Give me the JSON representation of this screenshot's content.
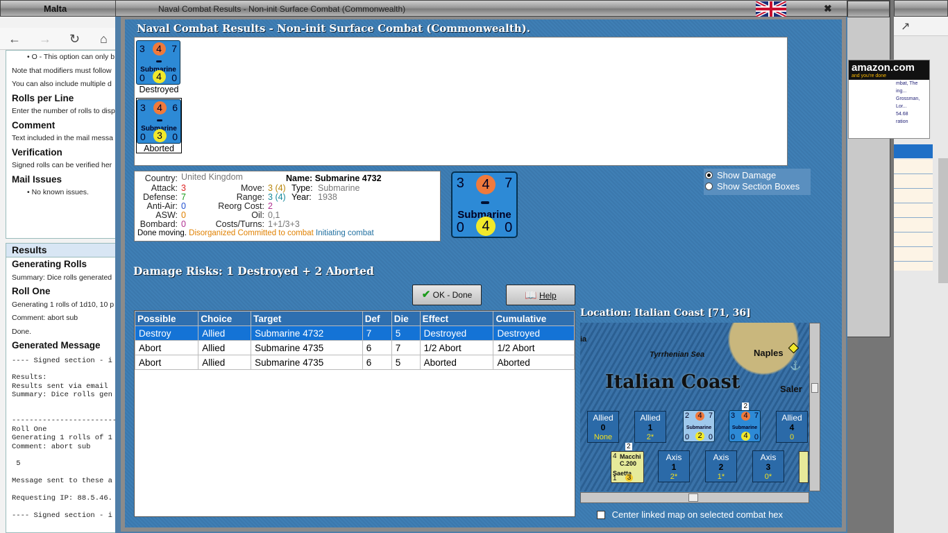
{
  "left_browser": {
    "window_title": "Malta",
    "doc_lines": [
      {
        "kind": "bullet",
        "text": "O - This option can only b"
      },
      {
        "kind": "text",
        "text": "Note that modifiers must follow"
      },
      {
        "kind": "text",
        "text": "You can also include multiple d"
      },
      {
        "kind": "heading",
        "text": "Rolls per Line"
      },
      {
        "kind": "text",
        "text": "Enter the number of rolls to disp"
      },
      {
        "kind": "heading",
        "text": "Comment"
      },
      {
        "kind": "text",
        "text": "Text included in the mail messa"
      },
      {
        "kind": "heading",
        "text": "Verification"
      },
      {
        "kind": "text",
        "text": "Signed rolls can be verified her"
      },
      {
        "kind": "heading",
        "text": "Mail Issues"
      },
      {
        "kind": "bullet",
        "text": "No known issues."
      }
    ],
    "results_title": "Results",
    "results_lines": [
      {
        "kind": "heading",
        "text": "Generating Rolls"
      },
      {
        "kind": "text",
        "text": "Summary: Dice rolls generated"
      },
      {
        "kind": "heading",
        "text": "Roll One"
      },
      {
        "kind": "text",
        "text": "Generating 1 rolls of 1d10, 10 p"
      },
      {
        "kind": "text",
        "text": "Comment: abort sub"
      },
      {
        "kind": "text",
        "text": "Done."
      },
      {
        "kind": "heading",
        "text": "Generated Message"
      }
    ],
    "mono_text": "---- Signed section - i\n\nResults:\nResults sent via email\nSummary: Dice rolls gen\n\n\n------------------------\nRoll One\nGenerating 1 rolls of 1\nComment: abort sub\n\n 5\n\nMessage sent to these a\n\nRequesting IP: 88.5.46.\n\n---- Signed section - i"
  },
  "right_bg": {
    "ad_logo": "amazon.com",
    "ad_tag": "and you're done",
    "ad_lines": [
      "mbat, The",
      "ing...",
      "Grossman, Lor...",
      "54.68",
      "ration"
    ]
  },
  "dialog": {
    "window_title": "Naval Combat Results - Non-init Surface Combat (Commonwealth)",
    "heading": "Naval Combat Results - Non-init Surface Combat (Commonwealth).",
    "results_units": [
      {
        "attack": "3",
        "def": "4",
        "move": "7",
        "name": "Submarine",
        "oil": "0",
        "die": "4",
        "range": "0",
        "status": "Destroyed"
      },
      {
        "attack": "3",
        "def": "4",
        "move": "6",
        "name": "Submarine",
        "oil": "0",
        "die": "3",
        "range": "0",
        "status": "Aborted"
      }
    ],
    "info": {
      "country_label": "Country:",
      "country": "United Kingdom",
      "name_label": "Name:",
      "name": "Submarine 4732",
      "attack_label": "Attack:",
      "attack": "3",
      "defense_label": "Defense:",
      "defense": "7",
      "aa_label": "Anti-Air:",
      "aa": "0",
      "asw_label": "ASW:",
      "asw": "0",
      "bombard_label": "Bombard:",
      "bombard": "0",
      "move_label": "Move:",
      "move": "3",
      "move_paren": "(4)",
      "type_label": "Type:",
      "type": "Submarine",
      "range_label": "Range:",
      "range": "3",
      "range_paren": "(4)",
      "year_label": "Year:",
      "year": "1938",
      "reorg_label": "Reorg Cost:",
      "reorg": "2",
      "oil_label": "Oil:",
      "oil": "0,1",
      "costs_label": "Costs/Turns:",
      "costs": "1+1/3+3",
      "status_done": "Done moving.",
      "status_disorg": "Disorganized",
      "status_committed": "Committed to combat",
      "status_init": "Initiating combat"
    },
    "big_counter": {
      "attack": "3",
      "def": "4",
      "move": "7",
      "name": "Submarine",
      "oil": "0",
      "die": "4",
      "range": "0"
    },
    "options": {
      "show_damage": "Show Damage",
      "show_sections": "Show Section Boxes"
    },
    "damage_risks": "Damage Risks:  1 Destroyed + 2 Aborted",
    "ok_button": "OK - Done",
    "help_button": "Help",
    "location": "Location:  Italian Coast [71, 36]",
    "table": {
      "headers": [
        "Possible",
        "Choice",
        "Target",
        "Def",
        "Die",
        "Effect",
        "Cumulative"
      ],
      "rows": [
        [
          "Destroy",
          "Allied",
          "Submarine 4732",
          "7",
          "5",
          "Destroyed",
          "Destroyed"
        ],
        [
          "Abort",
          "Allied",
          "Submarine 4735",
          "6",
          "7",
          "1/2 Abort",
          "1/2 Abort"
        ],
        [
          "Abort",
          "Allied",
          "Submarine 4735",
          "6",
          "5",
          "Aborted",
          "Aborted"
        ]
      ]
    },
    "map": {
      "sea_label": "Tyrrhenian Sea",
      "city": "Naples",
      "city2": "Saler",
      "region": "Italian Coast",
      "edge": "ia",
      "hexes_top": [
        {
          "side": "Allied",
          "num": "0",
          "sub": "None"
        },
        {
          "side": "Allied",
          "num": "1",
          "sub": "2*"
        },
        {
          "side": "Allied",
          "num": "4",
          "sub": "0"
        }
      ],
      "hexes_bottom": [
        {
          "side": "Axis",
          "num": "1",
          "sub": "2*"
        },
        {
          "side": "Axis",
          "num": "2",
          "sub": "1*"
        },
        {
          "side": "Axis",
          "num": "3",
          "sub": "0*"
        }
      ],
      "mini1": {
        "a": "2",
        "d": "4",
        "m": "7",
        "nm": "Submarine",
        "o": "0",
        "die": "2",
        "r": "0"
      },
      "mini2": {
        "a": "3",
        "d": "4",
        "m": "7",
        "nm": "Submarine",
        "o": "0",
        "die": "4",
        "r": "0",
        "stack": "2"
      },
      "air": {
        "top": "4",
        "name": "Macchi C.200",
        "sub": "Saetta",
        "a": "1",
        "b": "3",
        "stack": "2"
      }
    },
    "center_label": "Center linked map on selected combat hex"
  }
}
